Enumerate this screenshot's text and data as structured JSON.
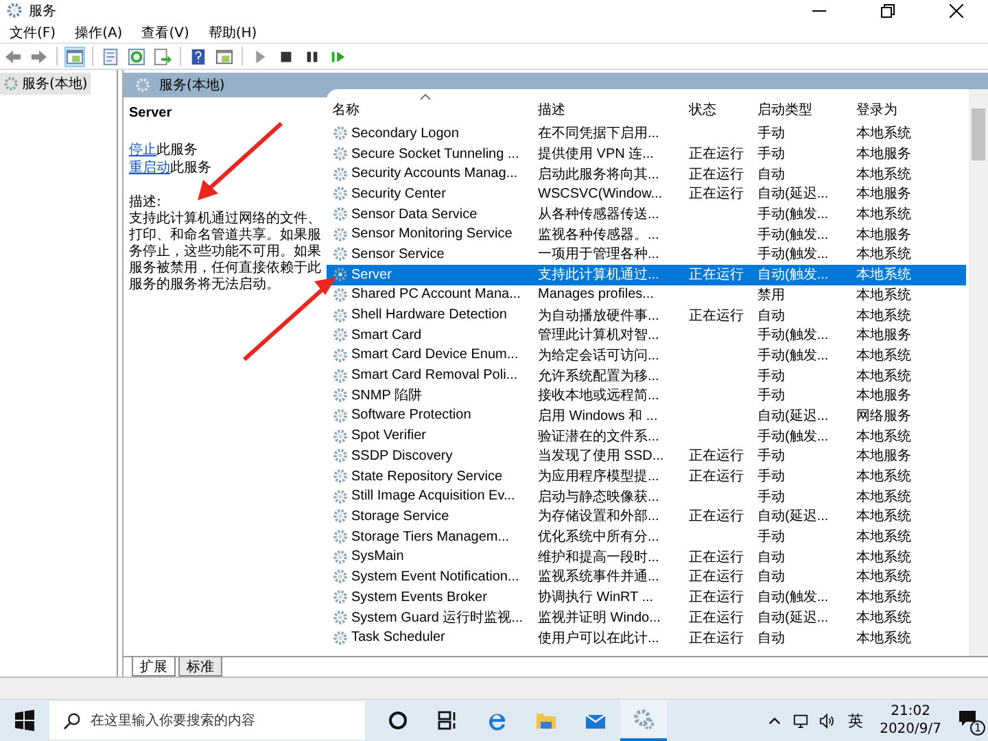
{
  "window": {
    "title": "服务"
  },
  "menu": [
    "文件(F)",
    "操作(A)",
    "查看(V)",
    "帮助(H)"
  ],
  "tree": {
    "items": [
      {
        "label": "服务(本地)",
        "selected": true
      }
    ]
  },
  "panel_header": "服务(本地)",
  "details": {
    "title": "Server",
    "actions": [
      {
        "link": "停止",
        "rest": "此服务"
      },
      {
        "link": "重启动",
        "rest": "此服务"
      }
    ],
    "description_label": "描述:",
    "description": "支持此计算机通过网络的文件、打印、和命名管道共享。如果服务停止，这些功能不可用。如果服务被禁用，任何直接依赖于此服务的服务将无法启动。"
  },
  "table": {
    "columns": [
      "名称",
      "描述",
      "状态",
      "启动类型",
      "登录为"
    ],
    "rows": [
      {
        "name": "Secondary Logon",
        "description": "在不同凭据下启用...",
        "status": "",
        "startup": "手动",
        "logon": "本地系统",
        "selected": false
      },
      {
        "name": "Secure Socket Tunneling ...",
        "description": "提供使用 VPN 连...",
        "status": "正在运行",
        "startup": "手动",
        "logon": "本地服务",
        "selected": false
      },
      {
        "name": "Security Accounts Manag...",
        "description": "启动此服务将向其...",
        "status": "正在运行",
        "startup": "自动",
        "logon": "本地系统",
        "selected": false
      },
      {
        "name": "Security Center",
        "description": "WSCSVC(Window...",
        "status": "正在运行",
        "startup": "自动(延迟...",
        "logon": "本地服务",
        "selected": false
      },
      {
        "name": "Sensor Data Service",
        "description": "从各种传感器传送...",
        "status": "",
        "startup": "手动(触发...",
        "logon": "本地系统",
        "selected": false
      },
      {
        "name": "Sensor Monitoring Service",
        "description": "监视各种传感器。...",
        "status": "",
        "startup": "手动(触发...",
        "logon": "本地服务",
        "selected": false
      },
      {
        "name": "Sensor Service",
        "description": "一项用于管理各种...",
        "status": "",
        "startup": "手动(触发...",
        "logon": "本地系统",
        "selected": false
      },
      {
        "name": "Server",
        "description": "支持此计算机通过...",
        "status": "正在运行",
        "startup": "自动(触发...",
        "logon": "本地系统",
        "selected": true
      },
      {
        "name": "Shared PC Account Mana...",
        "description": "Manages profiles...",
        "status": "",
        "startup": "禁用",
        "logon": "本地系统",
        "selected": false
      },
      {
        "name": "Shell Hardware Detection",
        "description": "为自动播放硬件事...",
        "status": "正在运行",
        "startup": "自动",
        "logon": "本地系统",
        "selected": false
      },
      {
        "name": "Smart Card",
        "description": "管理此计算机对智...",
        "status": "",
        "startup": "手动(触发...",
        "logon": "本地服务",
        "selected": false
      },
      {
        "name": "Smart Card Device Enum...",
        "description": "为给定会话可访问...",
        "status": "",
        "startup": "手动(触发...",
        "logon": "本地系统",
        "selected": false
      },
      {
        "name": "Smart Card Removal Poli...",
        "description": "允许系统配置为移...",
        "status": "",
        "startup": "手动",
        "logon": "本地系统",
        "selected": false
      },
      {
        "name": "SNMP 陷阱",
        "description": "接收本地或远程简...",
        "status": "",
        "startup": "手动",
        "logon": "本地服务",
        "selected": false
      },
      {
        "name": "Software Protection",
        "description": "启用 Windows 和 ...",
        "status": "",
        "startup": "自动(延迟...",
        "logon": "网络服务",
        "selected": false
      },
      {
        "name": "Spot Verifier",
        "description": "验证潜在的文件系...",
        "status": "",
        "startup": "手动(触发...",
        "logon": "本地系统",
        "selected": false
      },
      {
        "name": "SSDP Discovery",
        "description": "当发现了使用 SSD...",
        "status": "正在运行",
        "startup": "手动",
        "logon": "本地服务",
        "selected": false
      },
      {
        "name": "State Repository Service",
        "description": "为应用程序模型提...",
        "status": "正在运行",
        "startup": "手动",
        "logon": "本地系统",
        "selected": false
      },
      {
        "name": "Still Image Acquisition Ev...",
        "description": "启动与静态映像获...",
        "status": "",
        "startup": "手动",
        "logon": "本地系统",
        "selected": false
      },
      {
        "name": "Storage Service",
        "description": "为存储设置和外部...",
        "status": "正在运行",
        "startup": "自动(延迟...",
        "logon": "本地系统",
        "selected": false
      },
      {
        "name": "Storage Tiers Managem...",
        "description": "优化系统中所有分...",
        "status": "",
        "startup": "手动",
        "logon": "本地系统",
        "selected": false
      },
      {
        "name": "SysMain",
        "description": "维护和提高一段时...",
        "status": "正在运行",
        "startup": "自动",
        "logon": "本地系统",
        "selected": false
      },
      {
        "name": "System Event Notification...",
        "description": "监视系统事件并通...",
        "status": "正在运行",
        "startup": "自动",
        "logon": "本地系统",
        "selected": false
      },
      {
        "name": "System Events Broker",
        "description": "协调执行 WinRT ...",
        "status": "正在运行",
        "startup": "自动(触发...",
        "logon": "本地系统",
        "selected": false
      },
      {
        "name": "System Guard 运行时监视...",
        "description": "监视并证明 Windo...",
        "status": "正在运行",
        "startup": "自动(延迟...",
        "logon": "本地系统",
        "selected": false
      },
      {
        "name": "Task Scheduler",
        "description": "使用户可以在此计...",
        "status": "正在运行",
        "startup": "自动",
        "logon": "本地系统",
        "selected": false
      }
    ]
  },
  "bottom_tabs": [
    {
      "label": "扩展",
      "selected": true
    },
    {
      "label": "标准",
      "selected": false
    }
  ],
  "taskbar": {
    "search_placeholder": "在这里输入你要搜索的内容",
    "ime": "英",
    "time": "21:02",
    "date": "2020/9/7",
    "notifications": "1"
  }
}
